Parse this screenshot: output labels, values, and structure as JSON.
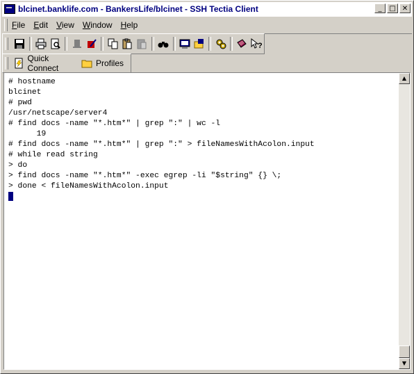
{
  "window": {
    "title": "blcinet.banklife.com - BankersLife/blcinet - SSH Tectia Client",
    "minimize": "_",
    "maximize": "□",
    "close": "✕"
  },
  "menu": [
    "File",
    "Edit",
    "View",
    "Window",
    "Help"
  ],
  "toolbar": {
    "icons": [
      {
        "name": "save-icon",
        "glyph": "💾"
      },
      {
        "name": "print-icon",
        "glyph": "🖶"
      },
      {
        "name": "print-preview-icon",
        "glyph": "🔍"
      },
      {
        "name": "disconnect-icon",
        "glyph": "▮"
      },
      {
        "name": "connect-icon",
        "glyph": "✎"
      },
      {
        "name": "copy-icon",
        "glyph": "⎘"
      },
      {
        "name": "paste-icon",
        "glyph": "📋"
      },
      {
        "name": "paste-disabled-icon",
        "glyph": "📋"
      },
      {
        "name": "find-icon",
        "glyph": "🔭"
      },
      {
        "name": "new-terminal-icon",
        "glyph": "▣"
      },
      {
        "name": "file-transfer-icon",
        "glyph": "📁"
      },
      {
        "name": "settings-icon",
        "glyph": "⚙"
      },
      {
        "name": "help-book-icon",
        "glyph": "📕"
      },
      {
        "name": "context-help-icon",
        "glyph": "⁇"
      }
    ]
  },
  "quickbar": {
    "quick_connect": "Quick Connect",
    "profiles": "Profiles"
  },
  "terminal": {
    "lines": [
      "# hostname",
      "blcinet",
      "# pwd",
      "/usr/netscape/server4",
      "# find docs -name \"*.htm*\" | grep \":\" | wc -l",
      "      19",
      "# find docs -name \"*.htm*\" | grep \":\" > fileNamesWithAcolon.input",
      "# while read string",
      "> do",
      "> find docs -name \"*.htm*\" -exec egrep -li \"$string\" {} \\;",
      "> done < fileNamesWithAcolon.input"
    ]
  }
}
